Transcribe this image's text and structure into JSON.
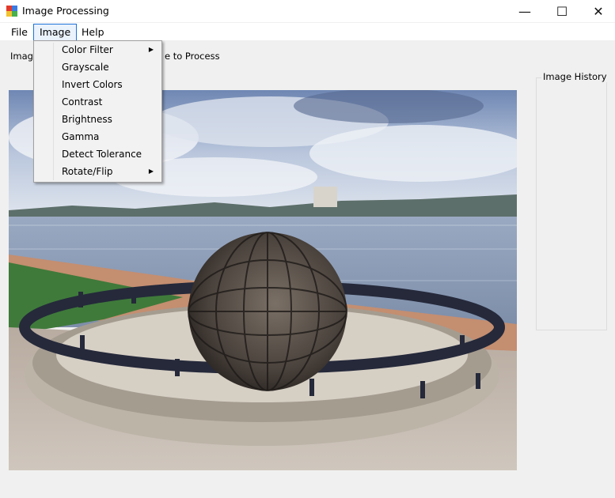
{
  "window": {
    "title": "Image Processing",
    "controls": {
      "minimize": "—",
      "maximize": "☐",
      "close": "✕"
    }
  },
  "menubar": {
    "items": [
      {
        "label": "File"
      },
      {
        "label": "Image"
      },
      {
        "label": "Help"
      }
    ]
  },
  "status": {
    "prefix": "Image",
    "suffix": "e to Process"
  },
  "image_history": {
    "label": "Image History"
  },
  "image_menu": {
    "items": [
      {
        "label": "Color Filter",
        "submenu": true
      },
      {
        "label": "Grayscale",
        "submenu": false
      },
      {
        "label": "Invert Colors",
        "submenu": false
      },
      {
        "label": "Contrast",
        "submenu": false
      },
      {
        "label": "Brightness",
        "submenu": false
      },
      {
        "label": "Gamma",
        "submenu": false
      },
      {
        "label": "Detect Tolerance",
        "submenu": false
      },
      {
        "label": "Rotate/Flip",
        "submenu": true
      }
    ],
    "submenu_arrow": "▶"
  },
  "colors": {
    "menu_highlight_border": "#1e74d8",
    "menu_highlight_bg": "#eaf2fc",
    "window_bg": "#f0f0f0"
  }
}
